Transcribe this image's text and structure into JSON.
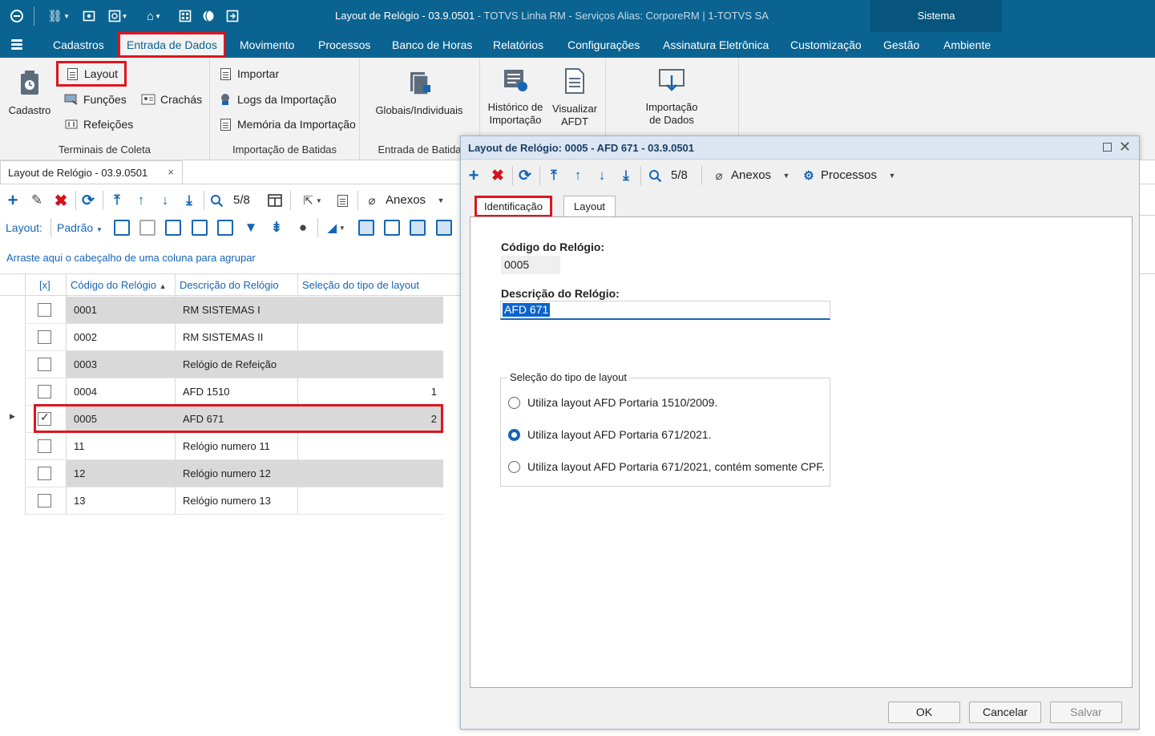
{
  "window": {
    "title_main": "Layout de Relógio - 03.9.0501",
    "title_rest": " - TOTVS Linha RM - Serviços  Alias: CorporeRM | 1-TOTVS SA",
    "sistema_tab": "Sistema"
  },
  "menu": {
    "items": [
      "Cadastros",
      "Entrada de Dados",
      "Movimento",
      "Processos",
      "Banco de Horas",
      "Relatórios",
      "Configurações",
      "Assinatura Eletrônica",
      "Customização",
      "Gestão",
      "Ambiente"
    ],
    "active": "Entrada de Dados"
  },
  "ribbon": {
    "cadastro": "Cadastro",
    "layout": "Layout",
    "funcoes": "Funções",
    "crachas": "Crachás",
    "refeicoes": "Refeições",
    "group1": "Terminais de Coleta",
    "importar": "Importar",
    "logs": "Logs da Importação",
    "memoria": "Memória da Importação",
    "group2": "Importação de Batidas",
    "globais": "Globais/Individuais",
    "group3": "Entrada de Batida",
    "historico_1": "Histórico de",
    "historico_2": "Importação",
    "visualizar_1": "Visualizar",
    "visualizar_2": "AFDT",
    "importacao_1": "Importação",
    "importacao_2": "de Dados"
  },
  "doc_tab": {
    "label": "Layout de Relógio - 03.9.0501",
    "close": "×"
  },
  "toolbar": {
    "counter": "5/8",
    "anexos": "Anexos"
  },
  "toolbar2": {
    "layout_label": "Layout:",
    "padrao": "Padrão"
  },
  "group_hint": "Arraste aqui o cabeçalho de uma coluna para agrupar",
  "grid": {
    "columns": [
      "[x]",
      "Código do Relógio",
      "Descrição do Relógio",
      "Seleção do tipo de layout"
    ],
    "rows": [
      {
        "code": "0001",
        "desc": "RM SISTEMAS I",
        "tipo": "",
        "checked": false
      },
      {
        "code": "0002",
        "desc": "RM SISTEMAS II",
        "tipo": "",
        "checked": false
      },
      {
        "code": "0003",
        "desc": "Relógio de Refeição",
        "tipo": "",
        "checked": false
      },
      {
        "code": "0004",
        "desc": "AFD 1510",
        "tipo": "1",
        "checked": false
      },
      {
        "code": "0005",
        "desc": "AFD 671",
        "tipo": "2",
        "checked": true
      },
      {
        "code": "11",
        "desc": "Relógio numero 11",
        "tipo": "",
        "checked": false
      },
      {
        "code": "12",
        "desc": "Relógio numero 12",
        "tipo": "",
        "checked": false
      },
      {
        "code": "13",
        "desc": "Relógio numero 13",
        "tipo": "",
        "checked": false
      }
    ]
  },
  "dialog": {
    "title": "Layout de Relógio: 0005 - AFD 671 - 03.9.0501",
    "counter": "5/8",
    "anexos": "Anexos",
    "processos": "Processos",
    "tabs": [
      "Identificação",
      "Layout"
    ],
    "codigo_label": "Código do Relógio:",
    "codigo_value": "0005",
    "descricao_label": "Descrição do Relógio:",
    "descricao_value": "AFD 671",
    "fieldset_legend": "Seleção do tipo de layout",
    "options": [
      "Utiliza layout AFD Portaria 1510/2009.",
      "Utiliza layout AFD Portaria 671/2021.",
      "Utiliza layout AFD Portaria 671/2021, contém somente CPF."
    ],
    "selected_option": 1,
    "ok": "OK",
    "cancelar": "Cancelar",
    "salvar": "Salvar"
  },
  "colors": {
    "brand": "#0a6391",
    "highlight": "#e0141e",
    "accent": "#1665b4"
  }
}
